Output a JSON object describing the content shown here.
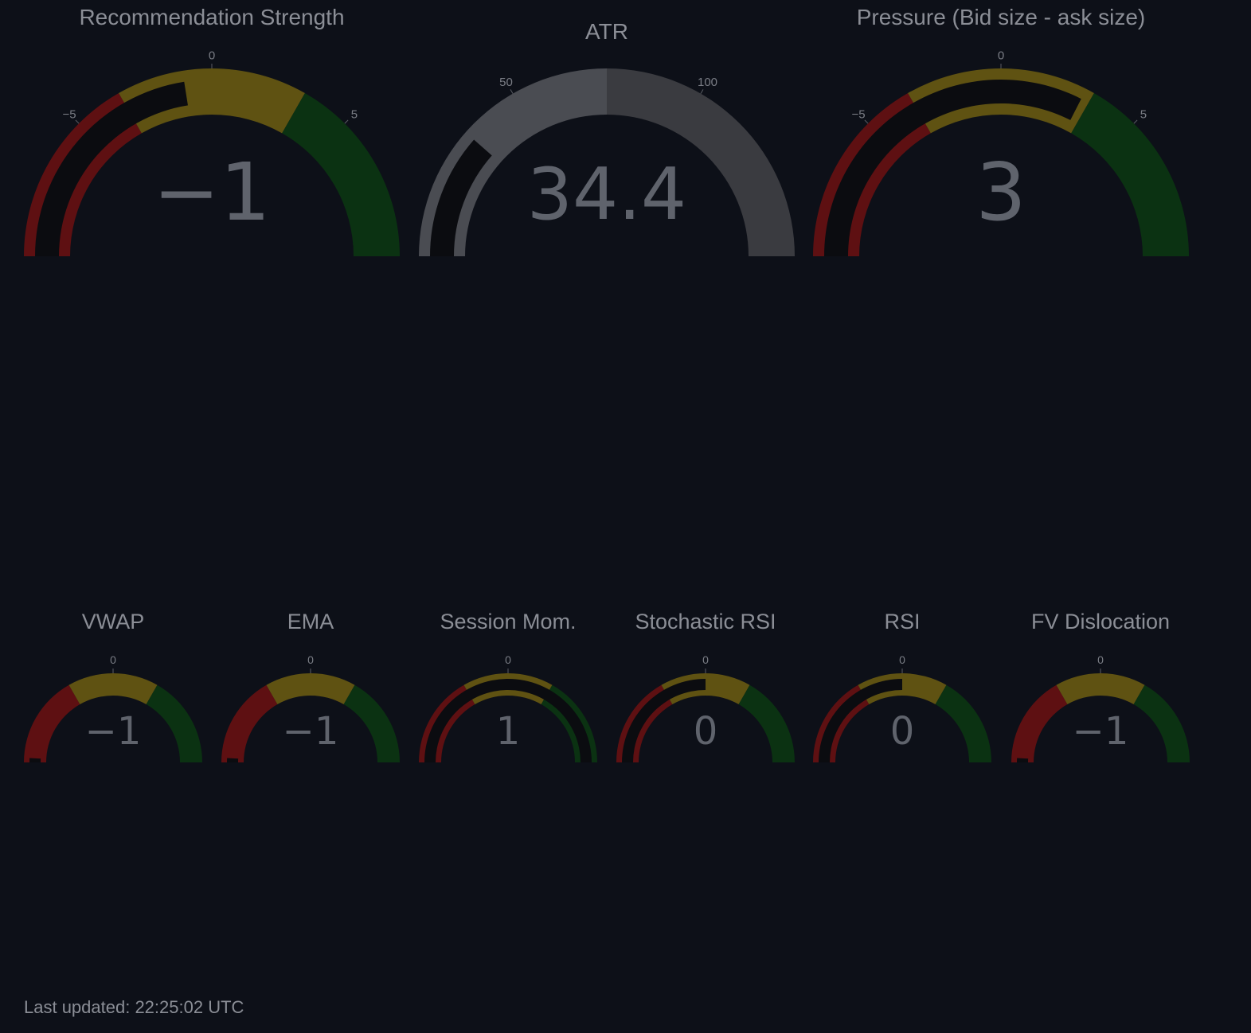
{
  "gauges": [
    {
      "title": "Recommendation Strength",
      "value": -1,
      "value_text": "−1",
      "range": [
        -10,
        10
      ],
      "ticks": [
        {
          "value": -5,
          "label": "−5"
        },
        {
          "value": 0,
          "label": "0"
        },
        {
          "value": 5,
          "label": "5"
        }
      ],
      "steps": [
        {
          "from": -10,
          "to": -3.3,
          "color": "#5e1012"
        },
        {
          "from": -3.3,
          "to": 3.3,
          "color": "#5f5212"
        },
        {
          "from": 3.3,
          "to": 10,
          "color": "#0b3212"
        }
      ],
      "bar_color": "#0b0c10"
    },
    {
      "title": "ATR",
      "value": 34.4,
      "value_text": "34.4",
      "range": [
        0,
        150
      ],
      "ticks": [
        {
          "value": 50,
          "label": "50"
        },
        {
          "value": 100,
          "label": "100"
        }
      ],
      "steps": [
        {
          "from": 0,
          "to": 75,
          "color": "#4a4c52"
        },
        {
          "from": 75,
          "to": 150,
          "color": "#3a3b40"
        }
      ],
      "bar_color": "#0b0c10"
    },
    {
      "title": "Pressure (Bid size - ask size)",
      "value": 3,
      "value_text": "3",
      "range": [
        -10,
        10
      ],
      "ticks": [
        {
          "value": -5,
          "label": "−5"
        },
        {
          "value": 0,
          "label": "0"
        },
        {
          "value": 5,
          "label": "5"
        }
      ],
      "steps": [
        {
          "from": -10,
          "to": -3.3,
          "color": "#5e1012"
        },
        {
          "from": -3.3,
          "to": 3.3,
          "color": "#5f5212"
        },
        {
          "from": 3.3,
          "to": 10,
          "color": "#0b3212"
        }
      ],
      "bar_color": "#0b0c10"
    },
    {
      "title": "VWAP",
      "value": -1,
      "value_text": "−1",
      "range": [
        -1,
        1
      ],
      "ticks": [
        {
          "value": 0,
          "label": "0"
        }
      ],
      "steps": [
        {
          "from": -1,
          "to": -0.33,
          "color": "#5e1012"
        },
        {
          "from": -0.33,
          "to": 0.33,
          "color": "#5f5212"
        },
        {
          "from": 0.33,
          "to": 1,
          "color": "#0b3212"
        }
      ],
      "bar_color": "#0b0c10"
    },
    {
      "title": "EMA",
      "value": -1,
      "value_text": "−1",
      "range": [
        -1,
        1
      ],
      "ticks": [
        {
          "value": 0,
          "label": "0"
        }
      ],
      "steps": [
        {
          "from": -1,
          "to": -0.33,
          "color": "#5e1012"
        },
        {
          "from": -0.33,
          "to": 0.33,
          "color": "#5f5212"
        },
        {
          "from": 0.33,
          "to": 1,
          "color": "#0b3212"
        }
      ],
      "bar_color": "#0b0c10"
    },
    {
      "title": "Session Mom.",
      "value": 1,
      "value_text": "1",
      "range": [
        -1,
        1
      ],
      "ticks": [
        {
          "value": 0,
          "label": "0"
        }
      ],
      "steps": [
        {
          "from": -1,
          "to": -0.33,
          "color": "#5e1012"
        },
        {
          "from": -0.33,
          "to": 0.33,
          "color": "#5f5212"
        },
        {
          "from": 0.33,
          "to": 1,
          "color": "#0b3212"
        }
      ],
      "bar_color": "#0b0c10"
    },
    {
      "title": "Stochastic RSI",
      "value": 0,
      "value_text": "0",
      "range": [
        -1,
        1
      ],
      "ticks": [
        {
          "value": 0,
          "label": "0"
        }
      ],
      "steps": [
        {
          "from": -1,
          "to": -0.33,
          "color": "#5e1012"
        },
        {
          "from": -0.33,
          "to": 0.33,
          "color": "#5f5212"
        },
        {
          "from": 0.33,
          "to": 1,
          "color": "#0b3212"
        }
      ],
      "bar_color": "#0b0c10"
    },
    {
      "title": "RSI",
      "value": 0,
      "value_text": "0",
      "range": [
        -1,
        1
      ],
      "ticks": [
        {
          "value": 0,
          "label": "0"
        }
      ],
      "steps": [
        {
          "from": -1,
          "to": -0.33,
          "color": "#5e1012"
        },
        {
          "from": -0.33,
          "to": 0.33,
          "color": "#5f5212"
        },
        {
          "from": 0.33,
          "to": 1,
          "color": "#0b3212"
        }
      ],
      "bar_color": "#0b0c10"
    },
    {
      "title": "FV Dislocation",
      "value": -1,
      "value_text": "−1",
      "range": [
        -1,
        1
      ],
      "ticks": [
        {
          "value": 0,
          "label": "0"
        }
      ],
      "steps": [
        {
          "from": -1,
          "to": -0.33,
          "color": "#5e1012"
        },
        {
          "from": -0.33,
          "to": 0.33,
          "color": "#5f5212"
        },
        {
          "from": 0.33,
          "to": 1,
          "color": "#0b3212"
        }
      ],
      "bar_color": "#0b0c10"
    }
  ],
  "footer": {
    "last_updated": "Last updated: 22:25:02 UTC"
  }
}
